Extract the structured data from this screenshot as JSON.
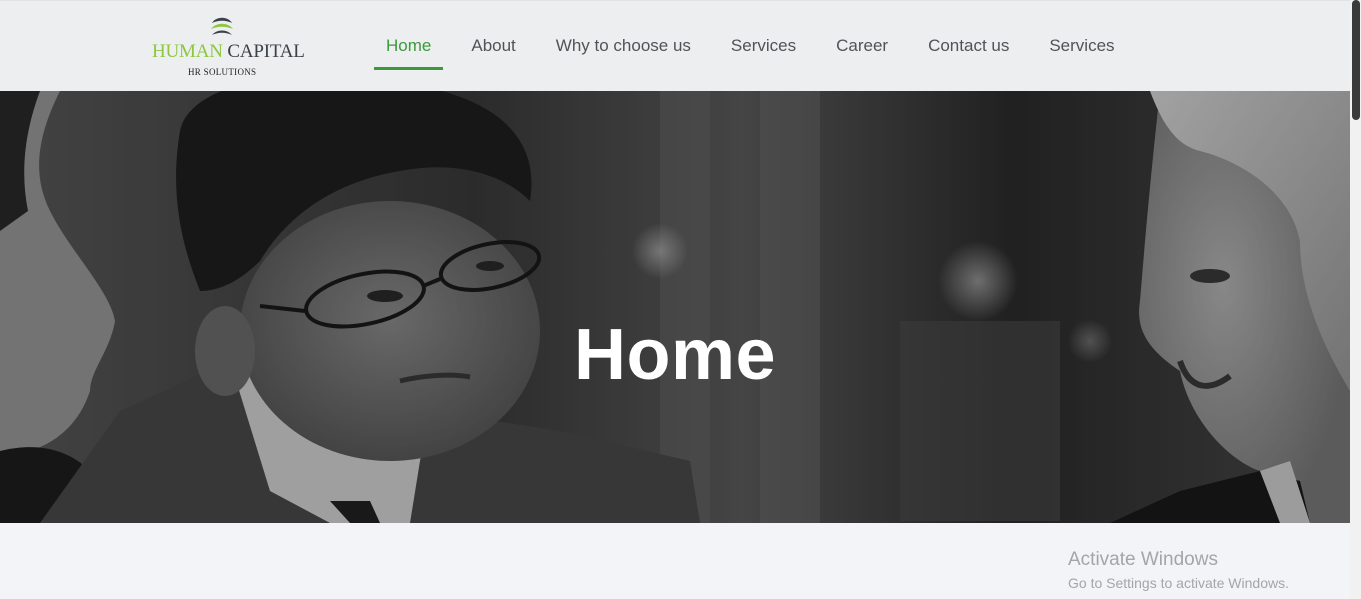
{
  "brand": {
    "name_part1": "HUMAN",
    "name_part2": "CAPITAL",
    "tagline": "HR SOLUTIONS",
    "icon": "logo-mark-icon",
    "color_primary": "#8dc63f",
    "color_dark": "#3b4148"
  },
  "nav": {
    "accent_color": "#3c9a3c",
    "items": [
      {
        "label": "Home",
        "active": true
      },
      {
        "label": "About",
        "active": false
      },
      {
        "label": "Why to choose us",
        "active": false
      },
      {
        "label": "Services",
        "active": false
      },
      {
        "label": "Career",
        "active": false
      },
      {
        "label": "Contact us",
        "active": false
      },
      {
        "label": "Services",
        "active": false
      }
    ]
  },
  "hero": {
    "title": "Home"
  },
  "watermark": {
    "title": "Activate Windows",
    "subtitle": "Go to Settings to activate Windows."
  }
}
